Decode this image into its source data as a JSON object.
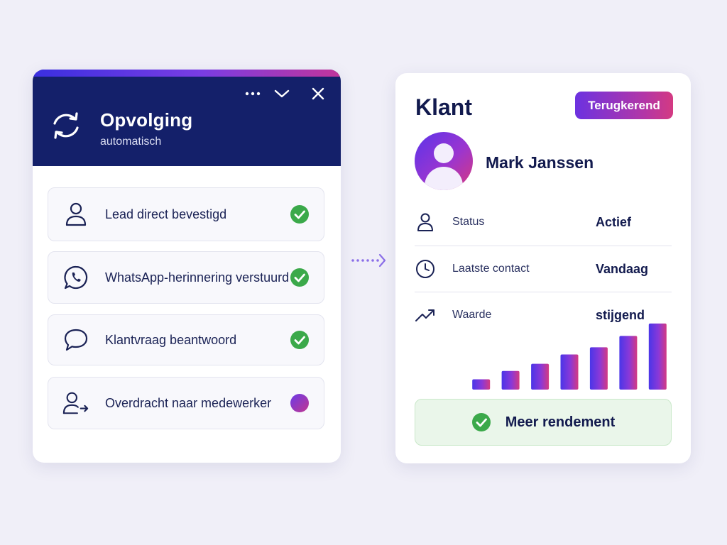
{
  "left_panel": {
    "title": "Opvolging",
    "subtitle": "automatisch",
    "window_controls": {
      "more_icon": "ellipsis-icon",
      "collapse_icon": "chevron-down-icon",
      "close_icon": "close-icon"
    },
    "steps": [
      {
        "label": "Lead direct bevestigd",
        "icon": "user-icon",
        "status": "done"
      },
      {
        "label": "WhatsApp-herinnering verstuurd",
        "icon": "whatsapp-icon",
        "status": "done"
      },
      {
        "label": "Klantvraag beantwoord",
        "icon": "chat-bubble-icon",
        "status": "done"
      },
      {
        "label": "Overdracht naar medewerker",
        "icon": "user-transfer-icon",
        "status": "pending"
      }
    ]
  },
  "right_panel": {
    "title": "Klant",
    "badge": "Terugkerend",
    "customer_name": "Mark Janssen",
    "rows": [
      {
        "icon": "user-icon",
        "label": "Status",
        "value": "Actief"
      },
      {
        "icon": "clock-icon",
        "label": "Laatste contact",
        "value": "Vandaag"
      },
      {
        "icon": "trend-up-icon",
        "label": "Waarde",
        "value": "stijgend"
      }
    ],
    "cta_label": "Meer rendement"
  },
  "colors": {
    "header_navy": "#14206a",
    "text_navy": "#121a4e",
    "check_green": "#3ba94a",
    "accent_violet": "#6c32e0",
    "accent_pink": "#d43a82"
  },
  "chart_data": {
    "type": "bar",
    "categories": [
      "1",
      "2",
      "3",
      "4",
      "5",
      "6",
      "7"
    ],
    "values": [
      1,
      1.8,
      2.5,
      3.4,
      4.1,
      5.2,
      6.4
    ],
    "title": "",
    "xlabel": "",
    "ylabel": "",
    "ylim": [
      0,
      6.6
    ],
    "grid": false,
    "color_gradient": [
      "#4a36e8",
      "#d43a82"
    ]
  }
}
